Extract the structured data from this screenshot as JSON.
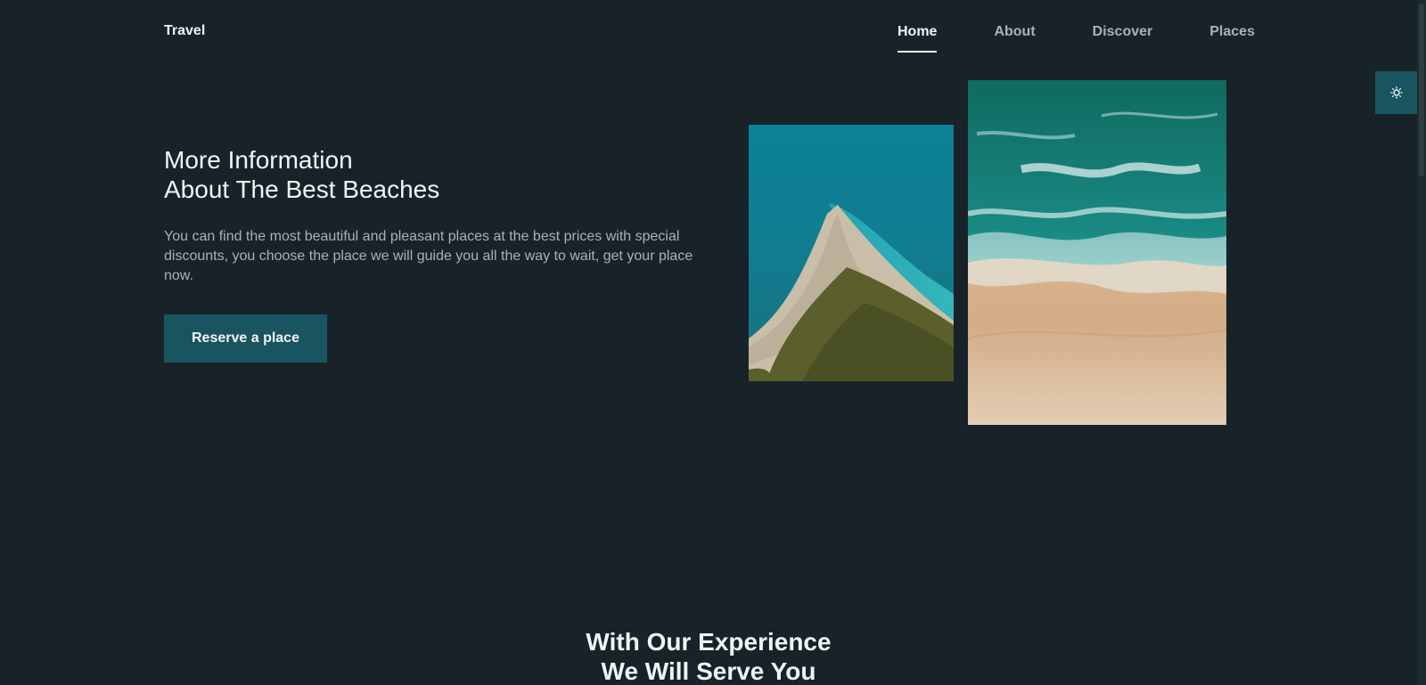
{
  "header": {
    "logo": "Travel",
    "nav": [
      {
        "label": "Home",
        "active": true
      },
      {
        "label": "About",
        "active": false
      },
      {
        "label": "Discover",
        "active": false
      },
      {
        "label": "Places",
        "active": false
      }
    ]
  },
  "theme_toggle": {
    "icon": "sun-icon"
  },
  "hero": {
    "title_line1": "More Information",
    "title_line2": "About The Best Beaches",
    "description": "You can find the most beautiful and pleasant places at the best prices with special discounts, you choose the place we will guide you all the way to wait, get your place now.",
    "button_label": "Reserve a place"
  },
  "section": {
    "title_line1": "With Our Experience",
    "title_line2": "We Will Serve You"
  },
  "colors": {
    "background": "#172328",
    "accent": "#1a5461",
    "text": "#f1f4f4",
    "muted_text": "#a9b3b6"
  }
}
